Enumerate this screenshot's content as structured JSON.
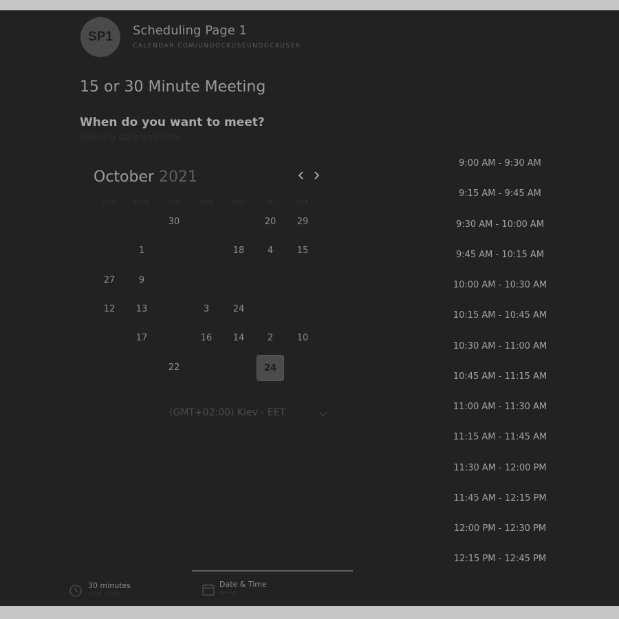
{
  "header": {
    "avatar_initials": "SP1",
    "page_title": "Scheduling Page 1",
    "url": "CALENDAR.COM/UNDOCKUSEUNDOCKUSER"
  },
  "meeting": {
    "title": "15 or 30 Minute Meeting",
    "question": "When do you want to meet?",
    "subtitle": "Select a date and time"
  },
  "calendar": {
    "month": "October",
    "year": "2021",
    "prev_icon": "chevron-left-icon",
    "next_icon": "chevron-right-icon",
    "weekdays": [
      "SUN",
      "MON",
      "TUE",
      "WED",
      "THU",
      "FRI",
      "SAT"
    ],
    "rows": [
      [
        {
          "label": "",
          "dim": true
        },
        {
          "label": "",
          "dim": true
        },
        {
          "label": "30"
        },
        {
          "label": "",
          "dim": true
        },
        {
          "label": "",
          "dim": true
        },
        {
          "label": "20"
        },
        {
          "label": "29"
        }
      ],
      [
        {
          "label": "",
          "dim": true
        },
        {
          "label": "1"
        },
        {
          "label": "",
          "dim": true
        },
        {
          "label": "",
          "dim": true
        },
        {
          "label": "18"
        },
        {
          "label": "4"
        },
        {
          "label": "15"
        }
      ],
      [
        {
          "label": "27"
        },
        {
          "label": "9"
        },
        {
          "label": "",
          "dim": true
        },
        {
          "label": "",
          "dim": true
        },
        {
          "label": "",
          "dim": true
        },
        {
          "label": "",
          "dim": true
        },
        {
          "label": "",
          "dim": true
        }
      ],
      [
        {
          "label": "12"
        },
        {
          "label": "13"
        },
        {
          "label": "",
          "dim": true
        },
        {
          "label": "3"
        },
        {
          "label": "24"
        },
        {
          "label": "",
          "dim": true
        },
        {
          "label": "",
          "dim": true
        }
      ],
      [
        {
          "label": "",
          "dim": true
        },
        {
          "label": "17"
        },
        {
          "label": "",
          "dim": true
        },
        {
          "label": "16"
        },
        {
          "label": "14"
        },
        {
          "label": "2"
        },
        {
          "label": "10"
        }
      ],
      [
        {
          "label": "",
          "dim": true
        },
        {
          "label": "",
          "dim": true
        },
        {
          "label": "22"
        },
        {
          "label": "",
          "dim": true
        },
        {
          "label": "",
          "dim": true
        },
        {
          "label": "24",
          "selected": true
        },
        {
          "label": "",
          "dim": true
        }
      ]
    ]
  },
  "timezone": {
    "value": "(GMT+02:00) Kiev - EET",
    "icon": "chevron-down-icon"
  },
  "time_slots": [
    "9:00 AM - 9:30 AM",
    "9:15 AM - 9:45 AM",
    "9:30 AM - 10:00 AM",
    "9:45 AM - 10:15 AM",
    "10:00 AM - 10:30 AM",
    "10:15 AM - 10:45 AM",
    "10:30 AM - 11:00 AM",
    "10:45 AM - 11:15 AM",
    "11:00 AM - 11:30 AM",
    "11:15 AM - 11:45 AM",
    "11:30 AM - 12:00 PM",
    "11:45 AM - 12:15 PM",
    "12:00 PM - 12:30 PM",
    "12:15 PM - 12:45 PM"
  ],
  "footer": {
    "steps": [
      {
        "label": "30 minutes",
        "sublabel": "HOW LONG",
        "icon": "clock-icon"
      },
      {
        "label": "Date & Time",
        "sublabel": "WHEN",
        "icon": "calendar-icon",
        "active": true
      }
    ]
  },
  "colors": {
    "background": "#222222",
    "frame": "#c6c6c6",
    "selected_day": "#4b4b4b"
  }
}
